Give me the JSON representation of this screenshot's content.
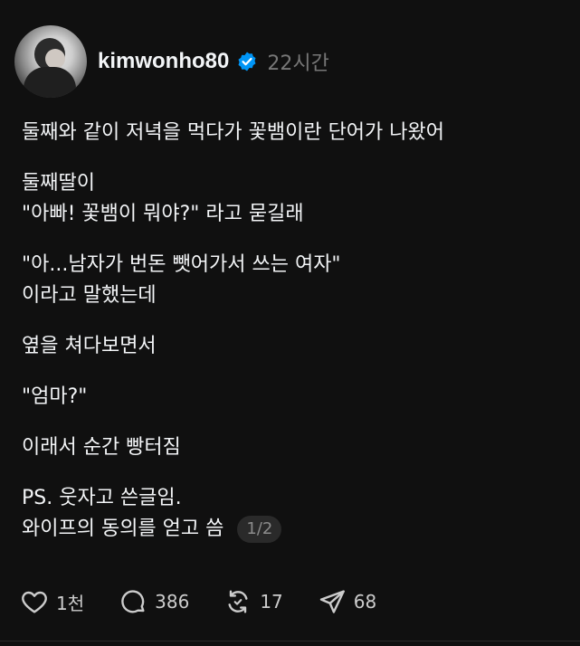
{
  "post": {
    "author": {
      "username": "kimwonho80",
      "verified": true,
      "avatar_icon": "profile-photo"
    },
    "time_ago": "22시간",
    "lines": [
      "둘째와 같이 저녁을 먹다가 꽃뱀이란 단어가 나왔어",
      "둘째딸이",
      "\"아빠! 꽃뱀이 뭐야?\" 라고 묻길래",
      "\"아...남자가 번돈 뺏어가서 쓰는 여자\"",
      "이라고 말했는데",
      "옆을 쳐다보면서",
      "\"엄마?\"",
      "이래서 순간 빵터짐",
      "PS. 웃자고 쓴글임.",
      "와이프의 동의를 얻고 씀"
    ],
    "page_indicator": "1/2"
  },
  "actions": {
    "like_count": "1천",
    "comment_count": "386",
    "repost_count": "17",
    "share_count": "68"
  },
  "colors": {
    "background": "#101010",
    "text": "#f3f5f7",
    "muted": "#777777",
    "verified": "#0095f6"
  }
}
